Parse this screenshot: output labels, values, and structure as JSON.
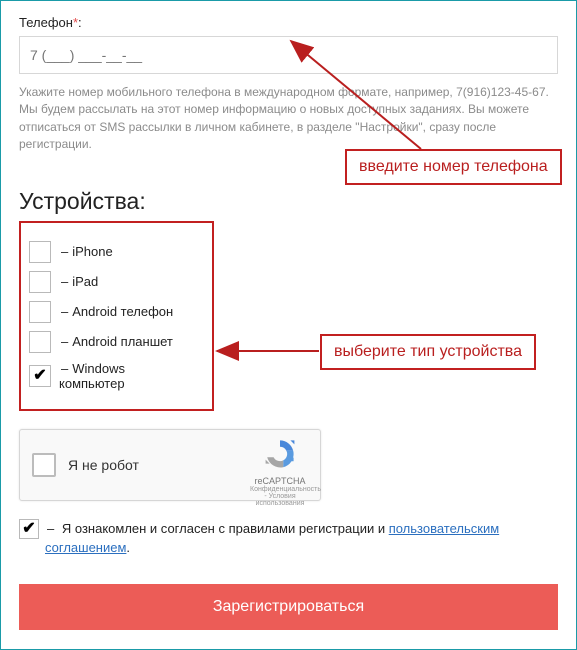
{
  "phone": {
    "label": "Телефон",
    "required_mark": "*",
    "colon": ":",
    "placeholder": "7 (___) ___-__-__",
    "help": "Укажите номер мобильного телефона в международном формате, например, 7(916)123-45-67. Мы будем рассылать на этот номер информацию о новых доступных заданиях. Вы можете отписаться от SMS рассылки в личном кабинете, в разделе \"Настройки\", сразу после регистрации."
  },
  "devices": {
    "title": "Устройства:",
    "dash": "–",
    "items": [
      {
        "label": "iPhone",
        "checked": false
      },
      {
        "label": "iPad",
        "checked": false
      },
      {
        "label": "Android телефон",
        "checked": false
      },
      {
        "label": "Android планшет",
        "checked": false
      },
      {
        "label": "Windows компьютер",
        "checked": true
      }
    ]
  },
  "callouts": {
    "phone": "введите номер телефона",
    "device": "выберите тип устройства"
  },
  "recaptcha": {
    "label": "Я не робот",
    "brand": "reCAPTCHA",
    "terms": "Конфиденциальность - Условия использования"
  },
  "agreement": {
    "checked": true,
    "dash": "–",
    "text_before": "Я ознакомлен и согласен с правилами регистрации и ",
    "link": "пользовательским соглашением",
    "period": "."
  },
  "register_button": "Зарегистрироваться",
  "colors": {
    "accent_red": "#c22020",
    "button_red": "#ec5c57",
    "border_teal": "#1a9ba8",
    "link_blue": "#2b6fbf"
  }
}
